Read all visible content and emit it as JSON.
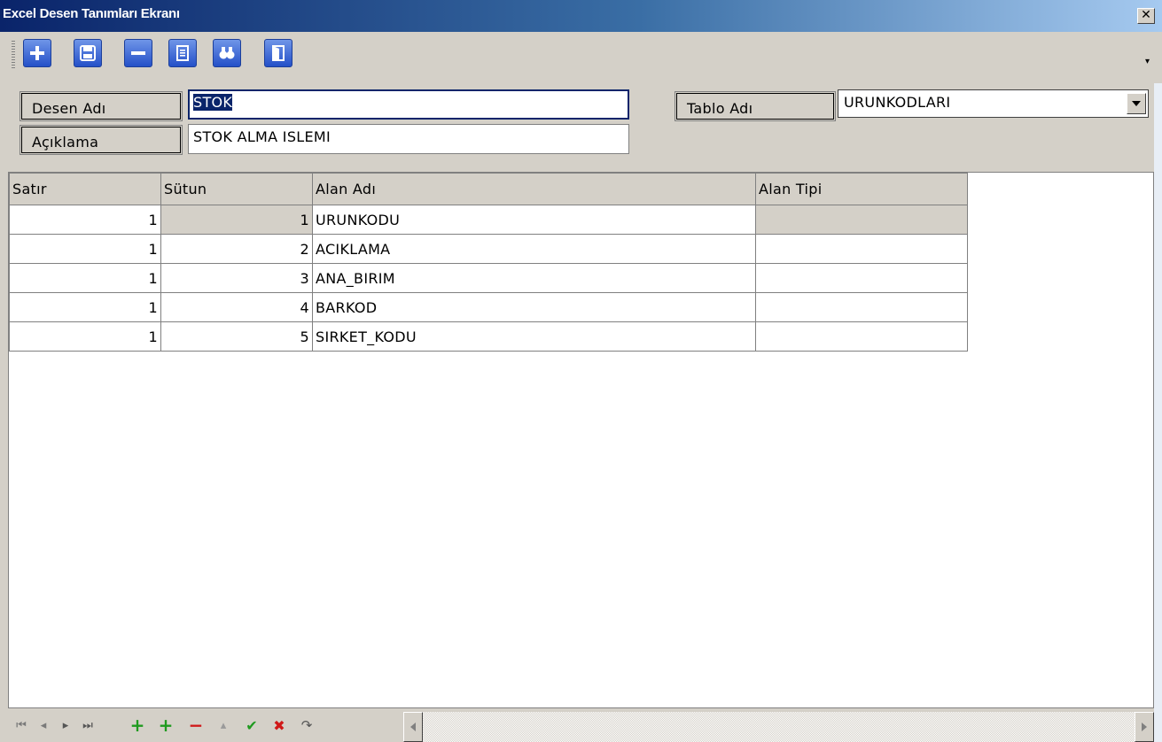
{
  "window": {
    "title": "Excel Desen Tanımları Ekranı",
    "close_glyph": "✕"
  },
  "toolbar": {
    "buttons": [
      {
        "name": "add-icon"
      },
      {
        "name": "save-icon"
      },
      {
        "name": "remove-icon"
      },
      {
        "name": "list-icon"
      },
      {
        "name": "find-icon"
      },
      {
        "name": "exit-icon"
      }
    ],
    "overflow_glyph": "▾"
  },
  "form": {
    "desen_adi_label": "Desen Adı",
    "desen_adi_value": "STOK",
    "aciklama_label": "Açıklama",
    "aciklama_value": "STOK ALMA ISLEMI",
    "tablo_adi_label": "Tablo Adı",
    "tablo_adi_value": "URUNKODLARI"
  },
  "grid": {
    "columns": [
      "Satır",
      "Sütun",
      "Alan Adı",
      "Alan Tipi"
    ],
    "rows": [
      {
        "satir": "1",
        "sutun": "1",
        "alan_adi": "URUNKODU",
        "alan_tipi": ""
      },
      {
        "satir": "1",
        "sutun": "2",
        "alan_adi": "ACIKLAMA",
        "alan_tipi": ""
      },
      {
        "satir": "1",
        "sutun": "3",
        "alan_adi": "ANA_BIRIM",
        "alan_tipi": ""
      },
      {
        "satir": "1",
        "sutun": "4",
        "alan_adi": "BARKOD",
        "alan_tipi": ""
      },
      {
        "satir": "1",
        "sutun": "5",
        "alan_adi": "SIRKET_KODU",
        "alan_tipi": ""
      }
    ]
  },
  "navigator": {
    "glyphs": [
      "⏮",
      "◂",
      "▸",
      "⏭",
      "+",
      "+",
      "−",
      "▴",
      "✔",
      "✖",
      "↷"
    ],
    "colors": {
      "green": "#1f9a1f",
      "red": "#d01818",
      "gray": "#7a7a7a"
    }
  },
  "colors": {
    "titlebar_dark": "#0a246a",
    "toolbar_blue": "#2450c8",
    "panel": "#d4d0c8"
  }
}
